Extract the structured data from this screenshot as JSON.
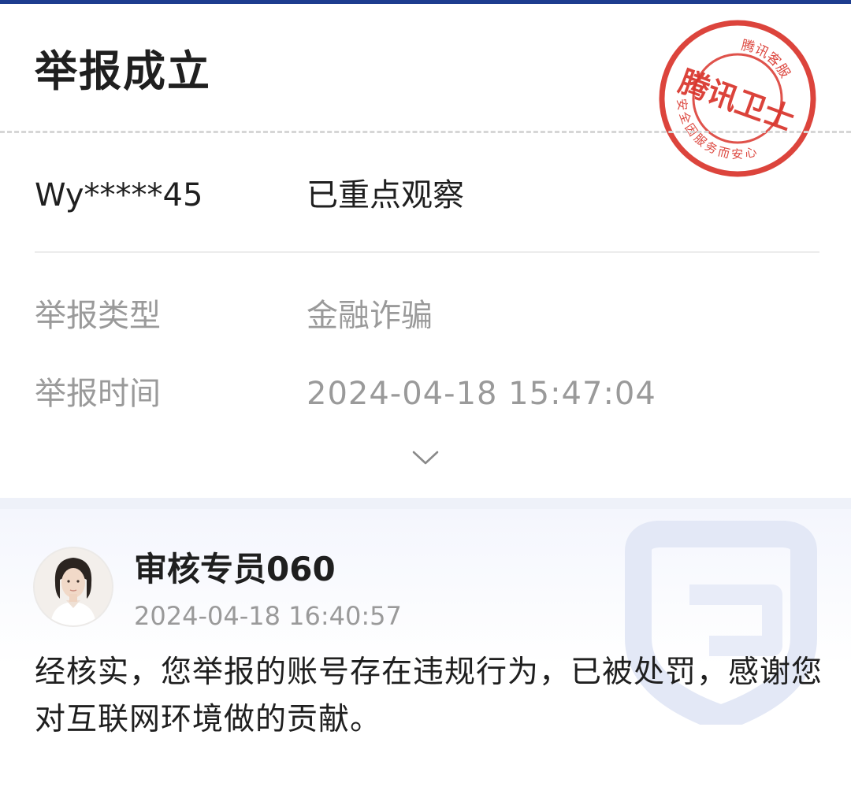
{
  "report": {
    "title": "举报成立",
    "account": "Wy*****45",
    "status": "已重点观察",
    "type_label": "举报类型",
    "type_value": "金融诈骗",
    "time_label": "举报时间",
    "time_value": "2024-04-18 15:47:04",
    "expand_icon": "chevron-down-icon"
  },
  "stamp": {
    "main_text": "腾讯卫士",
    "top_arc": "腾讯客服",
    "bottom_arc": "安全因服务而安心",
    "color": "#d9342b"
  },
  "review": {
    "reviewer_name": "审核专员060",
    "review_time": "2024-04-18 16:40:57",
    "message": "经核实，您举报的账号存在违规行为，已被处罚，感谢您对互联网环境做的贡献。",
    "avatar_icon": "avatar-photo",
    "watermark_icon": "shield-icon"
  },
  "colors": {
    "accent_strip": "#1d3d8f",
    "primary_text": "#1f1f1f",
    "secondary_text": "#9a9a9a",
    "band": "#eef1f9"
  }
}
